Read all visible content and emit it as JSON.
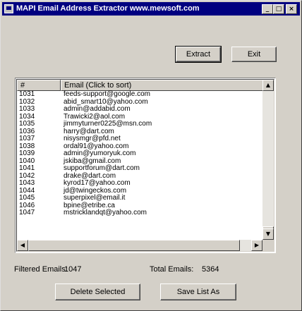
{
  "window": {
    "title": "MAPI Email Address Extractor  www.mewsoft.com"
  },
  "titlebar_buttons": {
    "minimize": "_",
    "maximize": "□",
    "close": "×"
  },
  "toolbar": {
    "extract_label": "Extract",
    "exit_label": "Exit"
  },
  "table": {
    "columns": [
      "#",
      "Email (Click to sort)"
    ],
    "rows": [
      [
        "1031",
        "feeds-support@google.com"
      ],
      [
        "1032",
        "abid_smart10@yahoo.com"
      ],
      [
        "1033",
        "admin@addabid.com"
      ],
      [
        "1034",
        "Trawicki2@aol.com"
      ],
      [
        "1035",
        "jimmyturner0225@msn.com"
      ],
      [
        "1036",
        "harry@dart.com"
      ],
      [
        "1037",
        "nisysmgr@pfd.net"
      ],
      [
        "1038",
        "ordal91@yahoo.com"
      ],
      [
        "1039",
        "admin@yumoryuk.com"
      ],
      [
        "1040",
        "jskiba@gmail.com"
      ],
      [
        "1041",
        "supportforum@dart.com"
      ],
      [
        "1042",
        "drake@dart.com"
      ],
      [
        "1043",
        "kyrod17@yahoo.com"
      ],
      [
        "1044",
        "jd@twingeckos.com"
      ],
      [
        "1045",
        "superpixel@email.it"
      ],
      [
        "1046",
        "bpine@etribe.ca"
      ],
      [
        "1047",
        "mstricklandqt@yahoo.com"
      ]
    ]
  },
  "scroll_glyphs": {
    "up": "▲",
    "down": "▼",
    "left": "◀",
    "right": "▶"
  },
  "stats": {
    "filtered_label": "Filtered Emails:",
    "filtered_value": "1047",
    "total_label": "Total Emails:",
    "total_value": "5364"
  },
  "actions": {
    "delete_label": "Delete Selected",
    "save_label": "Save List As"
  }
}
